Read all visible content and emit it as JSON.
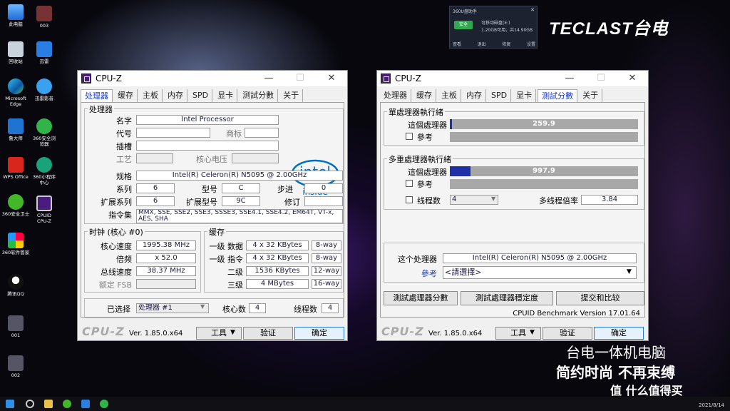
{
  "desktop": {
    "col1": [
      "此电脑",
      "回收站",
      "Microsoft Edge",
      "鲁大师",
      "WPS Office",
      "360安全卫士",
      "360软件管家",
      "腾讯QQ",
      "001",
      "002"
    ],
    "col2": [
      "003",
      "迅雷",
      "迅雷影音",
      "360安全浏览器",
      "360小程序中心",
      "CPUID CPU-Z"
    ]
  },
  "popup": {
    "title": "360U盘助手",
    "line1": "可移动磁盘(E:)",
    "line2": "1.20GB可用，共14.90GB",
    "badge": "安全",
    "actions": [
      "查看",
      "退出",
      "恢复",
      "设置"
    ]
  },
  "brand": {
    "logo": "TECLAST台电",
    "caption1": "台电一体机电脑",
    "caption2": "简约时尚 不再束缚",
    "watermark": "值 什么值得买",
    "date": "2021/8/14"
  },
  "cpuz_left": {
    "title": "CPU-Z",
    "tabs": [
      "处理器",
      "缓存",
      "主板",
      "内存",
      "SPD",
      "显卡",
      "测試分數",
      "关于"
    ],
    "processor": {
      "group": "处理器",
      "name_label": "名字",
      "name": "Intel Processor",
      "codename_label": "代号",
      "trademark_label": "商标",
      "socket_label": "插槽",
      "tech_label": "工艺",
      "voltage_label": "核心电压",
      "spec_label": "规格",
      "spec": "Intel(R) Celeron(R) N5095 @ 2.00GHz",
      "family_label": "系列",
      "family": "6",
      "model_label": "型号",
      "model": "C",
      "stepping_label": "步进",
      "stepping": "0",
      "extfamily_label": "扩展系列",
      "extfamily": "6",
      "extmodel_label": "扩展型号",
      "extmodel": "9C",
      "revision_label": "修订",
      "instr_label": "指令集",
      "instr": "MMX, SSE, SSE2, SSE3, SSSE3, SSE4.1, SSE4.2, EM64T, VT-x, AES, SHA"
    },
    "intel_logo": {
      "word": "intel",
      "sub": "inside"
    },
    "clocks": {
      "group": "时钟 (核心 #0)",
      "core_speed_label": "核心速度",
      "core_speed": "1995.38 MHz",
      "multiplier_label": "倍频",
      "multiplier": "x 52.0",
      "bus_label": "总线速度",
      "bus": "38.37 MHz",
      "fsb_label": "额定 FSB"
    },
    "cache": {
      "group": "缓存",
      "l1d_label": "一级 数据",
      "l1d": "4 x 32 KBytes",
      "l1d_way": "8-way",
      "l1i_label": "一级 指令",
      "l1i": "4 x 32 KBytes",
      "l1i_way": "8-way",
      "l2_label": "二级",
      "l2": "1536 KBytes",
      "l2_way": "12-way",
      "l3_label": "三级",
      "l3": "4 MBytes",
      "l3_way": "16-way"
    },
    "selection": {
      "label": "已选择",
      "value": "处理器 #1",
      "cores_label": "核心数",
      "cores": "4",
      "threads_label": "线程数",
      "threads": "4"
    },
    "footer": {
      "logo": "CPU-Z",
      "version": "Ver. 1.85.0.x64",
      "tools": "工具",
      "validate": "验证",
      "ok": "确定"
    }
  },
  "cpuz_right": {
    "title": "CPU-Z",
    "tabs": [
      "处理器",
      "缓存",
      "主板",
      "内存",
      "SPD",
      "显卡",
      "測試分數",
      "关于"
    ],
    "single": {
      "group": "單處理器執行緒",
      "this_label": "這個處理器",
      "this_value": "259.9",
      "this_fraction": 0.01,
      "ref_label": "參考"
    },
    "multi": {
      "group": "多重處理器執行緒",
      "this_label": "這個處理器",
      "this_value": "997.9",
      "this_fraction": 0.11,
      "ref_label": "參考",
      "threads_label": "线程数",
      "threads": "4",
      "ratio_label": "多线程倍率",
      "ratio": "3.84"
    },
    "this_cpu_label": "这个处理器",
    "this_cpu": "Intel(R) Celeron(R) N5095 @ 2.00GHz",
    "ref_label": "參考",
    "ref_value": "<請選擇>",
    "buttons": {
      "bench": "測試處理器分數",
      "stability": "測試處理器穩定度",
      "submit": "提交和比较"
    },
    "bench_version": "CPUID Benchmark Version 17.01.64",
    "footer": {
      "logo": "CPU-Z",
      "version": "Ver. 1.85.0.x64",
      "tools": "工具",
      "validate": "验证",
      "ok": "确定"
    }
  },
  "colors": {
    "tab_active": "#1b40d8",
    "bar_fill": "#1f2fa6",
    "bar_bg": "#a8a8a8",
    "intel_blue": "#0071c5"
  }
}
